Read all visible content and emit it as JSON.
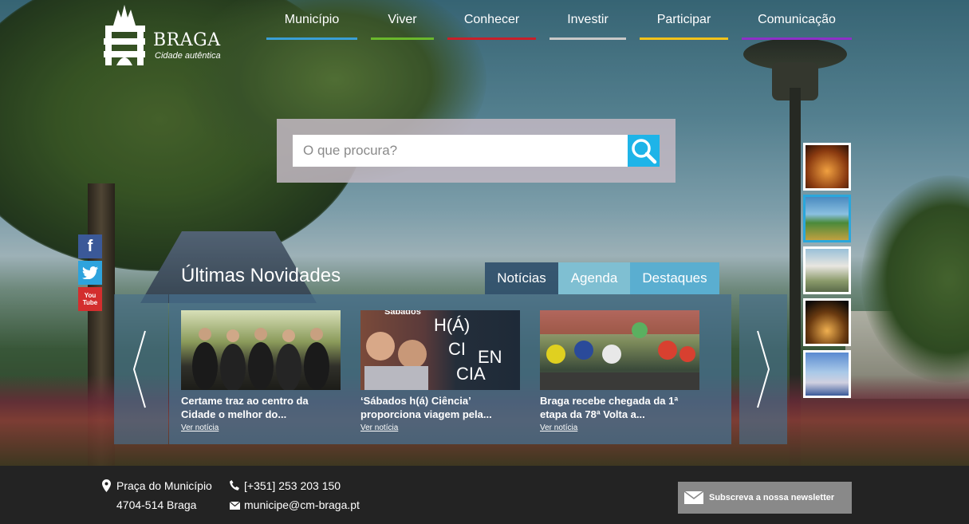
{
  "brand": {
    "name": "BRAGA",
    "tagline": "Cidade autêntica"
  },
  "nav": [
    {
      "label": "Município",
      "color": "#3a9fd6"
    },
    {
      "label": "Viver",
      "color": "#6ab82c"
    },
    {
      "label": "Conhecer",
      "color": "#c8202a"
    },
    {
      "label": "Investir",
      "color": "#c8c8c8"
    },
    {
      "label": "Participar",
      "color": "#f2c31a"
    },
    {
      "label": "Comunicação",
      "color": "#8e2fc8"
    }
  ],
  "search": {
    "placeholder": "O que procura?",
    "icon": "search-icon"
  },
  "social": [
    {
      "name": "facebook-icon",
      "glyph": "f"
    },
    {
      "name": "twitter-icon"
    },
    {
      "name": "youtube-icon",
      "line1": "You",
      "line2": "Tube"
    }
  ],
  "news": {
    "title": "Últimas Novidades",
    "tabs": [
      "Notícias",
      "Agenda",
      "Destaques"
    ],
    "cards": [
      {
        "headline": "Certame traz ao centro da Cidade o melhor do...",
        "more": "Ver notícia"
      },
      {
        "headline": "‘Sábados h(á) Ciência’ proporciona viagem pela...",
        "more": "Ver notícia",
        "image_text": [
          "Sábados",
          "H(Á)",
          "CI",
          "EN",
          "CIA"
        ]
      },
      {
        "headline": "Braga recebe chegada da 1ª etapa da 78ª Volta a...",
        "more": "Ver notícia"
      }
    ]
  },
  "footer": {
    "address_line1": "Praça do Município",
    "address_line2": "4704-514 Braga",
    "phone": "[+351] 253 203 150",
    "email": "municipe@cm-braga.pt",
    "newsletter": "Subscreva a nossa newsletter"
  }
}
